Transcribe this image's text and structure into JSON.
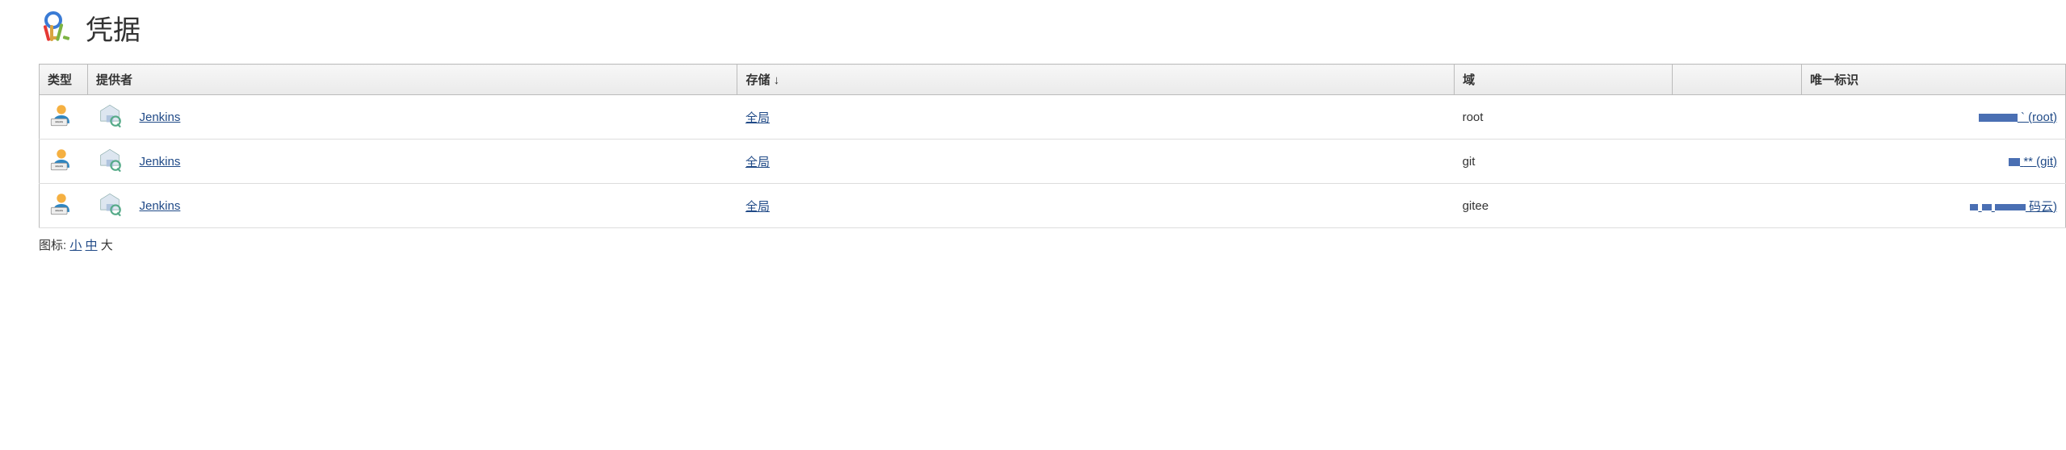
{
  "header": {
    "title": "凭据",
    "icon": "keys-icon"
  },
  "table": {
    "columns": {
      "type": "类型",
      "provider": "提供者",
      "store": "存储",
      "store_sort_indicator": "↓",
      "domain": "域",
      "name": "",
      "id": "唯一标识"
    },
    "rows": [
      {
        "type_icon": "user-password-icon",
        "provider_icon": "system-store-icon",
        "store_link": "Jenkins",
        "domain_link": "全局",
        "name": "root",
        "id_suffix": "` (root)",
        "id_redactions": [
          "r1"
        ]
      },
      {
        "type_icon": "user-password-icon",
        "provider_icon": "system-store-icon",
        "store_link": "Jenkins",
        "domain_link": "全局",
        "name": "git",
        "id_suffix": "** (git)",
        "id_redactions": [
          "r2"
        ]
      },
      {
        "type_icon": "user-password-icon",
        "provider_icon": "system-store-icon",
        "store_link": "Jenkins",
        "domain_link": "全局",
        "name": "gitee",
        "id_suffix": "码云)",
        "id_redactions": [
          "r3a",
          "r3b",
          "r3c"
        ]
      }
    ]
  },
  "footer": {
    "label": "图标:",
    "size_small": "小",
    "size_medium": "中",
    "size_large": "大"
  }
}
